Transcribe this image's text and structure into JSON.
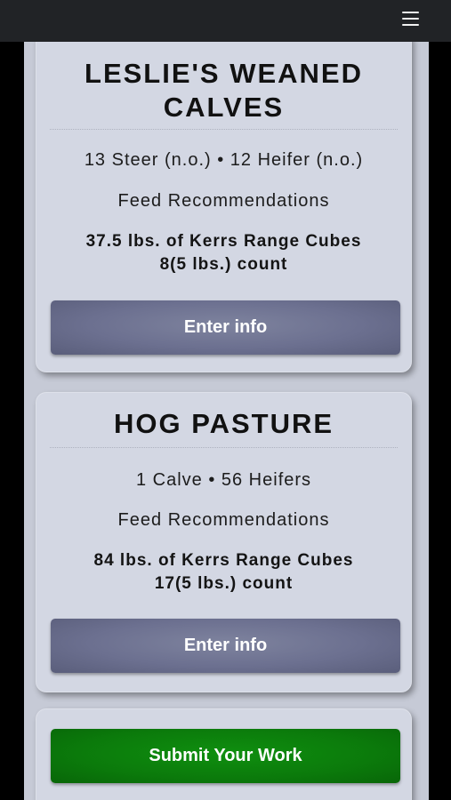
{
  "topbar": {
    "menu_icon": "hamburger-menu-icon"
  },
  "pastures": [
    {
      "title_line1": "LESLIE'S WEANED",
      "title_line2": "CALVES",
      "herd": "13 Steer (n.o.) • 12 Heifer (n.o.)",
      "feed_label": "Feed Recommendations",
      "feed_amount": "37.5 lbs. of Kerrs Range Cubes",
      "feed_count": "8(5 lbs.) count",
      "button_label": "Enter info"
    },
    {
      "title_line1": "HOG PASTURE",
      "herd": "1 Calve • 56 Heifers",
      "feed_label": "Feed Recommendations",
      "feed_amount": "84 lbs. of Kerrs Range Cubes",
      "feed_count": "17(5 lbs.) count",
      "button_label": "Enter info"
    }
  ],
  "submit": {
    "label": "Submit Your Work"
  },
  "colors": {
    "topbar": "#212326",
    "panel": "#c6cad6",
    "card": "#d3d7e3",
    "enter_button": "#6c7090",
    "submit_button": "#0b7a0b"
  }
}
